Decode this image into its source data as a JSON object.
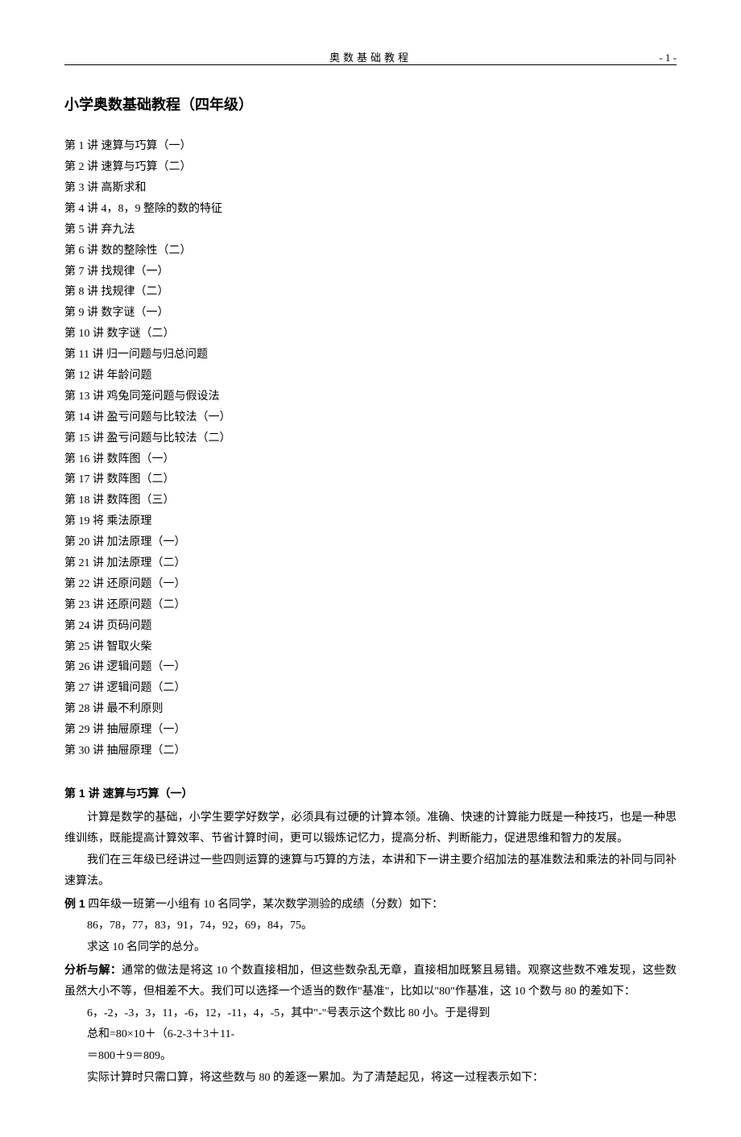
{
  "header": {
    "center": "奥数基础教程",
    "page": "- 1 -"
  },
  "title": "小学奥数基础教程（四年级）",
  "toc": [
    "第 1 讲 速算与巧算（一）",
    "第 2 讲 速算与巧算（二）",
    "第 3 讲 高斯求和",
    "第 4 讲 4，8，9 整除的数的特征",
    "第 5 讲 弃九法",
    "第 6 讲 数的整除性（二）",
    "第 7 讲 找规律（一）",
    "第 8 讲 找规律（二）",
    "第 9 讲 数字谜（一）",
    "第 10 讲 数字谜（二）",
    "第 11 讲 归一问题与归总问题",
    "第 12 讲 年龄问题",
    "第 13 讲 鸡兔同笼问题与假设法",
    "第 14 讲 盈亏问题与比较法（一）",
    "第 15 讲 盈亏问题与比较法（二）",
    "第 16 讲 数阵图（一）",
    "第 17 讲 数阵图（二）",
    "第 18 讲 数阵图（三）",
    "第 19 将 乘法原理",
    "第 20 讲 加法原理（一）",
    "第 21 讲 加法原理（二）",
    "第 22 讲 还原问题（一）",
    "第 23 讲 还原问题（二）",
    "第 24 讲 页码问题",
    "第 25 讲 智取火柴",
    "第 26 讲 逻辑问题（一）",
    "第 27 讲 逻辑问题（二）",
    "第 28 讲 最不利原则",
    "第 29 讲 抽屉原理（一）",
    "第 30 讲 抽屉原理（二）"
  ],
  "section": {
    "title": "第 1 讲 速算与巧算（一）",
    "p1": "计算是数学的基础，小学生要学好数学，必须具有过硬的计算本领。准确、快速的计算能力既是一种技巧，也是一种思维训练，既能提高计算效率、节省计算时间，更可以锻炼记忆力，提高分析、判断能力，促进思维和智力的发展。",
    "p2": "我们在三年级已经讲过一些四则运算的速算与巧算的方法，本讲和下一讲主要介绍加法的基准数法和乘法的补同与同补速算法。",
    "ex1_label": "例 1",
    "ex1_stem": " 四年级一班第一小组有 10 名同学，某次数学测验的成绩（分数）如下：",
    "ex1_data": "86，78，77，83，91，74，92，69，84，75。",
    "ex1_ask": "求这 10 名同学的总分。",
    "ans_label": "分析与解：",
    "ans_p1": "通常的做法是将这 10 个数直接相加，但这些数杂乱无章，直接相加既繁且易错。观察这些数不难发现，这些数虽然大小不等，但相差不大。我们可以选择一个适当的数作\"基准\"，比如以\"80\"作基准，这 10 个数与 80 的差如下：",
    "ans_p2": "6，-2，-3，3，11，-6，12，-11，4，-5，其中\"-\"号表示这个数比 80 小。于是得到",
    "ans_p3": "总和=80×10＋（6-2-3＋3＋11-",
    "ans_p4": "＝800＋9＝809。",
    "ans_p5": "实际计算时只需口算，将这些数与 80 的差逐一累加。为了清楚起见，将这一过程表示如下："
  }
}
